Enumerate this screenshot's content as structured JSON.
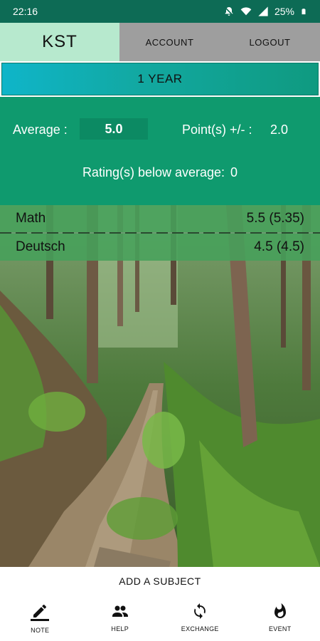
{
  "status_bar": {
    "time": "22:16",
    "battery": "25%",
    "icons": [
      "mute-icon",
      "wifi-icon",
      "signal-icon",
      "battery-icon"
    ]
  },
  "nav": {
    "app_title": "KST",
    "account": "ACCOUNT",
    "logout": "LOGOUT"
  },
  "period": "1 YEAR",
  "stats": {
    "average_label": "Average :",
    "average_value": "5.0",
    "points_label": "Point(s) +/- :",
    "points_value": "2.0",
    "below_label": "Rating(s) below average:",
    "below_value": "0"
  },
  "subjects": [
    {
      "name": "Math",
      "grade": "5.5 (5.35)"
    },
    {
      "name": "Deutsch",
      "grade": "4.5 (4.5)"
    }
  ],
  "add_subject": "ADD A SUBJECT",
  "bottom_nav": [
    {
      "label": "NOTE",
      "icon": "pencil-icon"
    },
    {
      "label": "HELP",
      "icon": "people-icon"
    },
    {
      "label": "EXCHANGE",
      "icon": "sync-icon"
    },
    {
      "label": "EVENT",
      "icon": "flame-icon"
    }
  ],
  "colors": {
    "status_bar": "#0d6b55",
    "app_tab": "#b7e9ce",
    "nav_gray": "#9e9e9e",
    "stats_panel": "#0f9a6e",
    "subject_row": "#46a05a"
  }
}
